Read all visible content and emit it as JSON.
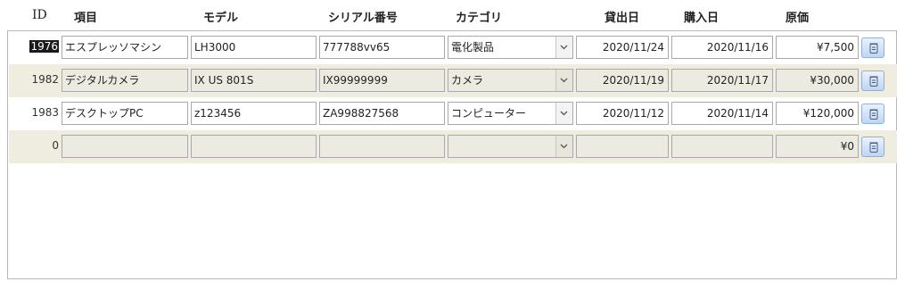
{
  "headers": {
    "id": "ID",
    "item": "項目",
    "model": "モデル",
    "serial": "シリアル番号",
    "category": "カテゴリ",
    "loan_date": "貸出日",
    "purchase_date": "購入日",
    "cost": "原価"
  },
  "rows": [
    {
      "id": "1976",
      "item": "エスプレッソマシン",
      "model": "LH3000",
      "serial": "777788vv65",
      "category": "電化製品",
      "loan_date": "2020/11/24",
      "purchase_date": "2020/11/16",
      "cost": "¥7,500"
    },
    {
      "id": "1982",
      "item": "デジタルカメラ",
      "model": "IX US 801S",
      "serial": "IX99999999",
      "category": "カメラ",
      "loan_date": "2020/11/19",
      "purchase_date": "2020/11/17",
      "cost": "¥30,000"
    },
    {
      "id": "1983",
      "item": "デスクトップPC",
      "model": "z123456",
      "serial": "ZA998827568",
      "category": "コンピューター",
      "loan_date": "2020/11/12",
      "purchase_date": "2020/11/14",
      "cost": "¥120,000"
    },
    {
      "id": "0",
      "item": "",
      "model": "",
      "serial": "",
      "category": "",
      "loan_date": "",
      "purchase_date": "",
      "cost": "¥0"
    }
  ],
  "icons": {
    "dropdown": "chevron-down-icon",
    "delete": "trash-icon"
  },
  "colors": {
    "alt_row": "#efece0",
    "button_border": "#8fb0dd",
    "button_fill": "#bfd5f3"
  }
}
